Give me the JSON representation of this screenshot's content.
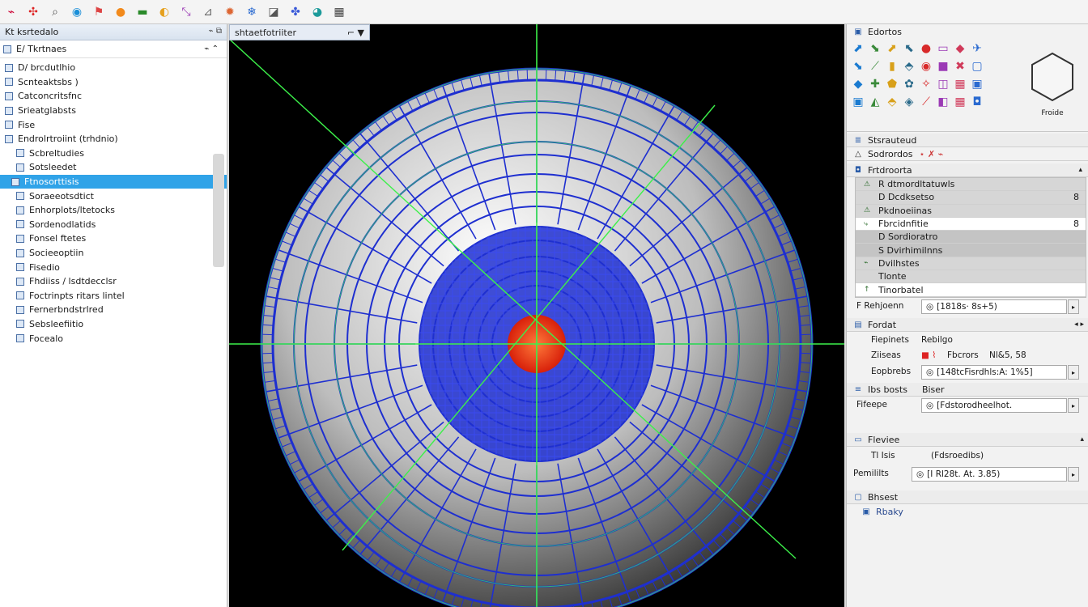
{
  "toolbar": {
    "icons": [
      "select-icon",
      "transform-icon",
      "zoom-icon",
      "globe-icon",
      "flag-icon",
      "sphere-icon",
      "line-icon",
      "color-wheel-icon",
      "scale-icon",
      "ruler-icon",
      "settings-icon",
      "snowflake-icon",
      "cube-icon",
      "puzzle-icon",
      "palette-icon",
      "grid-icon"
    ]
  },
  "left_panel": {
    "header": "Kt ksrtedalo",
    "root": "E/ Tkrtnaes",
    "tree": [
      "D/ brcdutlhio",
      "Scnteaktsbs )",
      "Catconcritsfnc",
      "Srieatglabsts",
      "Fise",
      "Endrolrtroiint (trhdnio)",
      "Scbreltudies",
      "Sotsleedet",
      "Ftnosorttisis",
      "Soraeeotsdtict",
      "Enhorplots/ltetocks",
      "Sordenodlatids",
      "Fonsel ftetes",
      "Socieeoptiin",
      "Fisedio",
      "Fhdiiss / lsdtdecclsr",
      "Foctrinpts ritars lintel",
      "Fernerbndstrlred",
      "Sebsleefiitio",
      "Focealo"
    ]
  },
  "viewport": {
    "tab_label": "shtaetfotriiter"
  },
  "right_panel": {
    "palette_title": "Edortos",
    "palette_preview_label": "Froide",
    "structure_title": "Stsrauteud",
    "structure_item": "Sodrordos",
    "props_title": "Frtdroorta",
    "props_rows": [
      "R dtmordltatuwls",
      "D Dcdksetso",
      "Pkdnoeiinas",
      "Fbrcidnfitie",
      "D Sordioratro",
      "S Dvirhimilnns",
      "Dvilhstes",
      "Tlonte",
      "Tinorbatel"
    ],
    "props_row_value": "8",
    "field1_label": "F Rehjoenn",
    "field1_value": "[1818s· 8s+5)",
    "sec2_title": "Fordat",
    "fields_a_label": "Fiepinets",
    "fields_a_value": "Rebilgo",
    "fields_b_label": "Ziiseas",
    "fields_b_mid": "Fbcrors",
    "fields_b_value": "Nl&5, 58",
    "field2_label": "Eopbrebs",
    "field2_value": "[148tcFisrdhls:A: 1%5]",
    "sec3_title": "Ibs bosts",
    "sec3_right": "Biser",
    "field3_label": "Fifeepe",
    "field3_value": "[Fdstorodheelhot.",
    "sec4_title": "Fleviee",
    "sec4_a": "Tl Isis",
    "sec4_b": "(Fdsroedibs)",
    "field4_label": "Pemililts",
    "field4_value": "[I Rl28t. At. 3.85)",
    "sec5_title": "Bhsest",
    "sec5_item": "Rbaky"
  },
  "colors": {
    "mesh_blue": "#1e2fd0",
    "axis_green": "#3cf04a",
    "core_red": "#ee3a10",
    "selection": "#30a3e8"
  }
}
